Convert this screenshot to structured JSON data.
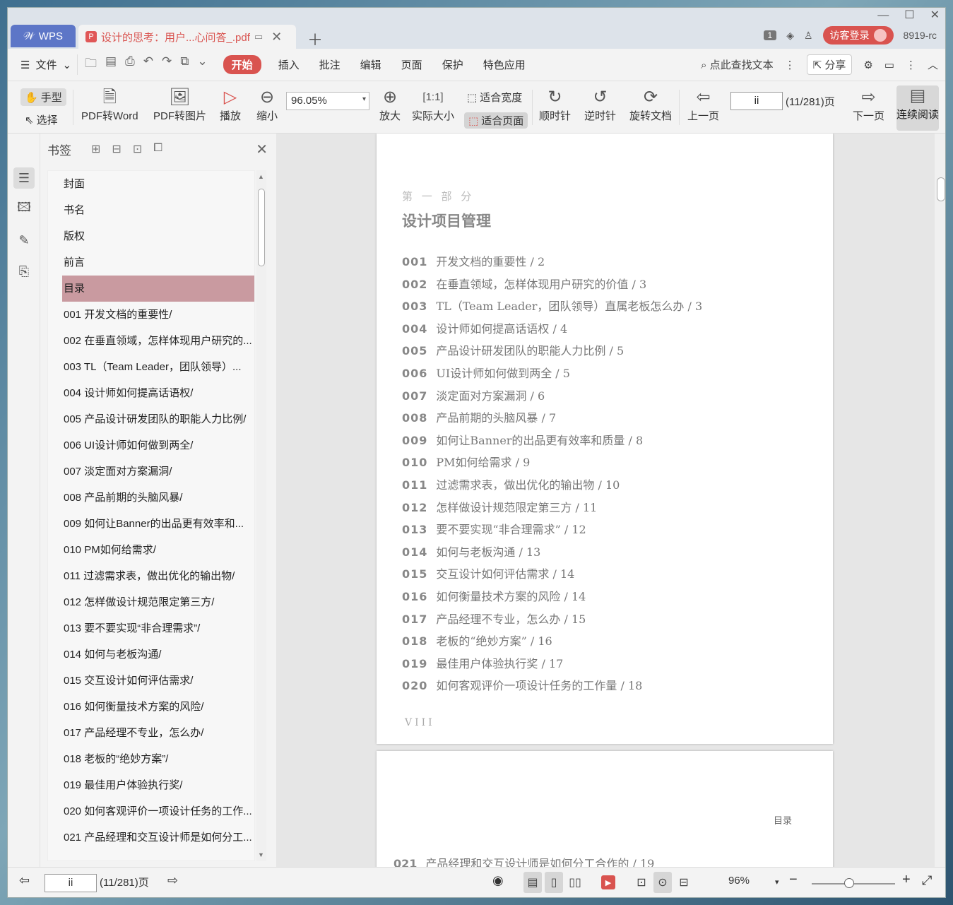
{
  "app": {
    "brand": "WPS",
    "doc_tab_title": "设计的思考：用户...心问答_.pdf",
    "new_tab_icon": "plus-icon",
    "badge_count": "1",
    "login_label": "访客登录",
    "user_suffix": "8919-rc"
  },
  "menu": {
    "file": "文件",
    "items": [
      "开始",
      "插入",
      "批注",
      "编辑",
      "页面",
      "保护",
      "特色应用"
    ],
    "search_placeholder": "点此查找文本",
    "share": "分享"
  },
  "toolbar": {
    "hand": "手型",
    "select": "选择",
    "pdf_to_word": "PDF转Word",
    "pdf_to_image": "PDF转图片",
    "play": "播放",
    "zoom_out": "缩小",
    "zoom_value": "96.05%",
    "zoom_in": "放大",
    "actual_size": "实际大小",
    "fit_width": "适合宽度",
    "fit_page": "适合页面",
    "rotate_cw": "顺时针",
    "rotate_ccw": "逆时针",
    "rotate_doc": "旋转文档",
    "prev_page": "上一页",
    "page_input": "ii",
    "page_count": "(11/281)页",
    "next_page": "下一页",
    "continuous": "连续阅读"
  },
  "bookmarks": {
    "title": "书签",
    "items": [
      "封面",
      "书名",
      "版权",
      "前言",
      "目录",
      "001 开发文档的重要性/",
      "002 在垂直领域，怎样体现用户研究的...",
      "003 TL（Team Leader，团队领导）...",
      "004 设计师如何提高话语权/",
      "005 产品设计研发团队的职能人力比例/",
      "006 UI设计师如何做到两全/",
      "007 淡定面对方案漏洞/",
      "008 产品前期的头脑风暴/",
      "009 如何让Banner的出品更有效率和...",
      "010 PM如何给需求/",
      "011 过滤需求表，做出优化的输出物/",
      "012 怎样做设计规范限定第三方/",
      "013 要不要实现“非合理需求”/",
      "014 如何与老板沟通/",
      "015 交互设计如何评估需求/",
      "016 如何衡量技术方案的风险/",
      "017 产品经理不专业，怎么办/",
      "018 老板的“绝妙方案”/",
      "019 最佳用户体验执行奖/",
      "020 如何客观评价一项设计任务的工作...",
      "021 产品经理和交互设计师是如何分工..."
    ],
    "selected_index": 4
  },
  "document": {
    "part_label": "第 一 部 分",
    "part_title": "设计项目管理",
    "toc": [
      {
        "num": "001",
        "text": "开发文档的重要性 / 2"
      },
      {
        "num": "002",
        "text": "在垂直领域，怎样体现用户研究的价值 / 3"
      },
      {
        "num": "003",
        "text": "TL（Team Leader，团队领导）直属老板怎么办 / 3"
      },
      {
        "num": "004",
        "text": "设计师如何提高话语权 / 4"
      },
      {
        "num": "005",
        "text": "产品设计研发团队的职能人力比例 / 5"
      },
      {
        "num": "006",
        "text": "UI设计师如何做到两全 / 5"
      },
      {
        "num": "007",
        "text": "淡定面对方案漏洞 / 6"
      },
      {
        "num": "008",
        "text": "产品前期的头脑风暴 / 7"
      },
      {
        "num": "009",
        "text": "如何让Banner的出品更有效率和质量 / 8"
      },
      {
        "num": "010",
        "text": "PM如何给需求 / 9"
      },
      {
        "num": "011",
        "text": "过滤需求表，做出优化的输出物 / 10"
      },
      {
        "num": "012",
        "text": "怎样做设计规范限定第三方 / 11"
      },
      {
        "num": "013",
        "text": "要不要实现“非合理需求” / 12"
      },
      {
        "num": "014",
        "text": "如何与老板沟通 / 13"
      },
      {
        "num": "015",
        "text": "交互设计如何评估需求 / 14"
      },
      {
        "num": "016",
        "text": "如何衡量技术方案的风险 / 14"
      },
      {
        "num": "017",
        "text": "产品经理不专业，怎么办 / 15"
      },
      {
        "num": "018",
        "text": "老板的“绝妙方案” / 16"
      },
      {
        "num": "019",
        "text": "最佳用户体验执行奖 / 17"
      },
      {
        "num": "020",
        "text": "如何客观评价一项设计任务的工作量 / 18"
      }
    ],
    "page_roman": "VIII",
    "page2_header": "目录",
    "page2_row": {
      "num": "021",
      "text": "产品经理和交互设计师是如何分工合作的 / 19"
    }
  },
  "status": {
    "page_input": "ii",
    "page_count": "(11/281)页",
    "zoom": "96%"
  }
}
